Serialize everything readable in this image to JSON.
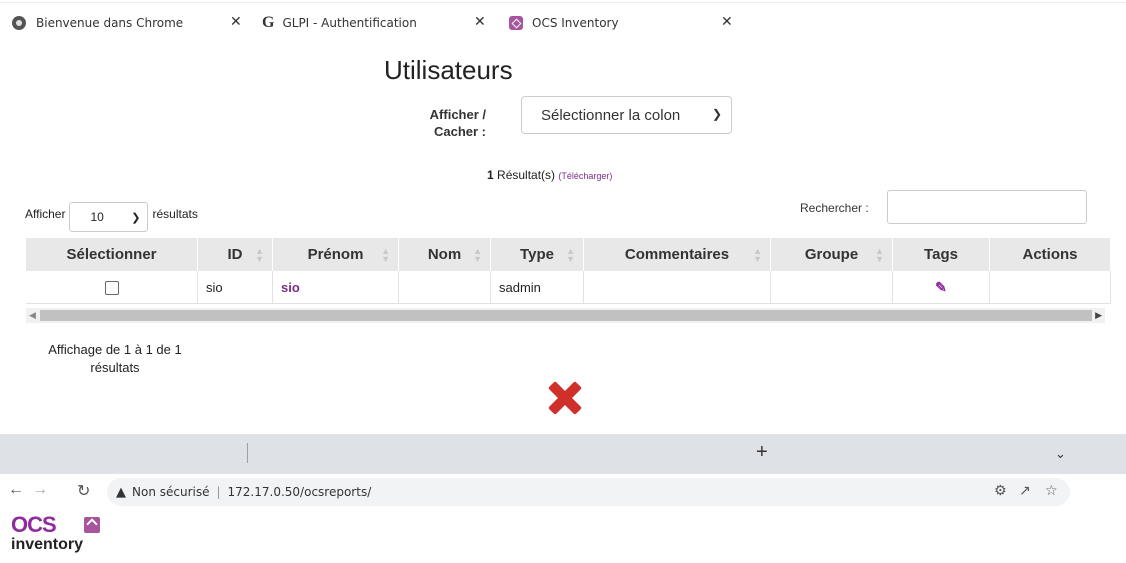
{
  "page": {
    "title": "Utilisateurs",
    "show_hide_label": "Afficher / Cacher :",
    "column_select_value": "Sélectionner la colon",
    "results_count": "1",
    "results_label": "Résultat(s)",
    "download_link": "(Télécharger)",
    "length_prefix": "Afficher",
    "length_value": "10",
    "length_suffix": "résultats",
    "search_label": "Rechercher :",
    "search_value": "",
    "info_text": "Affichage de 1 à 1 de 1 résultats"
  },
  "table": {
    "headers": [
      "Sélectionner",
      "ID",
      "Prénom",
      "Nom",
      "Type",
      "Commentaires",
      "Groupe",
      "Tags",
      "Actions"
    ],
    "rows": [
      {
        "id": "sio",
        "prenom": "sio",
        "nom": "",
        "type": "sadmin",
        "commentaires": "",
        "groupe": "",
        "tags_icon": "edit-icon",
        "actions": ""
      }
    ]
  },
  "overlay": {
    "icon": "red-x-icon"
  },
  "browser": {
    "tabs": [
      {
        "label": "Bienvenue dans Chrome",
        "icon": "chrome-icon",
        "active": false
      },
      {
        "label": "GLPI - Authentification",
        "icon": "glpi-icon",
        "active": false
      },
      {
        "label": "OCS Inventory",
        "icon": "ocs-icon",
        "active": true
      }
    ],
    "security_label": "Non sécurisé",
    "url": "172.17.0.50/ocsreports/"
  },
  "logo": {
    "line1": "OCS",
    "line2": "inventory"
  },
  "colors": {
    "accent": "#8e2c9e",
    "header_bg": "#e8e8e8",
    "error": "#d0302a",
    "tabbar": "#dee1e6"
  }
}
